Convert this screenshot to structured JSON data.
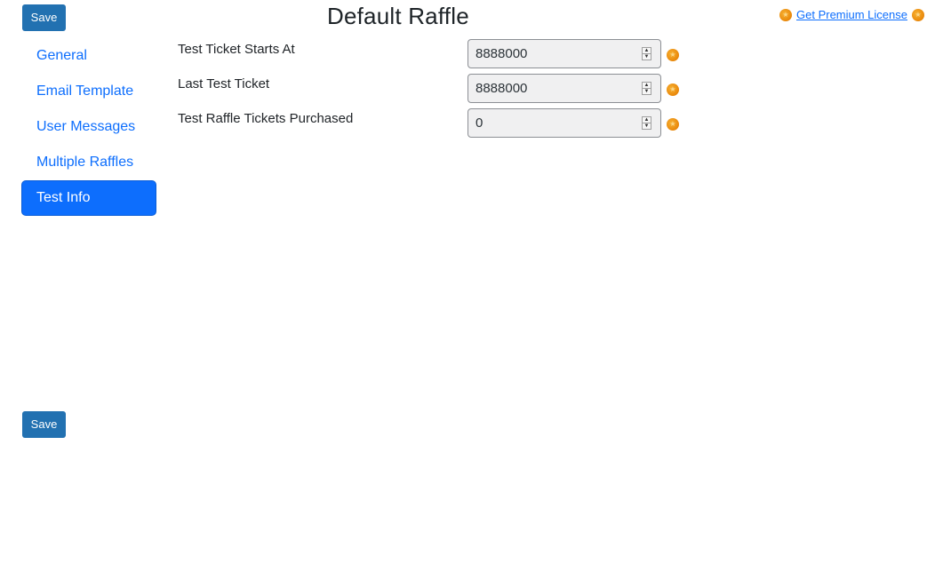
{
  "toolbar": {
    "save_top_label": "Save",
    "save_bottom_label": "Save"
  },
  "header": {
    "title": "Default Raffle",
    "premium_link": "Get Premium License "
  },
  "sidebar": {
    "items": [
      {
        "label": "General",
        "active": false
      },
      {
        "label": "Email Template",
        "active": false
      },
      {
        "label": "User Messages",
        "active": false
      },
      {
        "label": "Multiple Raffles",
        "active": false
      },
      {
        "label": "Test Info",
        "active": true
      }
    ]
  },
  "form": {
    "fields": [
      {
        "label": "Test Ticket Starts At",
        "value": "8888000",
        "icon": "premium-star-icon"
      },
      {
        "label": "Last Test Ticket",
        "value": "8888000",
        "icon": "premium-star-icon"
      },
      {
        "label": "Test Raffle Tickets Purchased",
        "value": "0",
        "icon": "premium-star-icon"
      }
    ]
  },
  "colors": {
    "accent": "#0d6efd",
    "save_button": "#2271b1",
    "premium_badge": "#ea8a0c"
  }
}
